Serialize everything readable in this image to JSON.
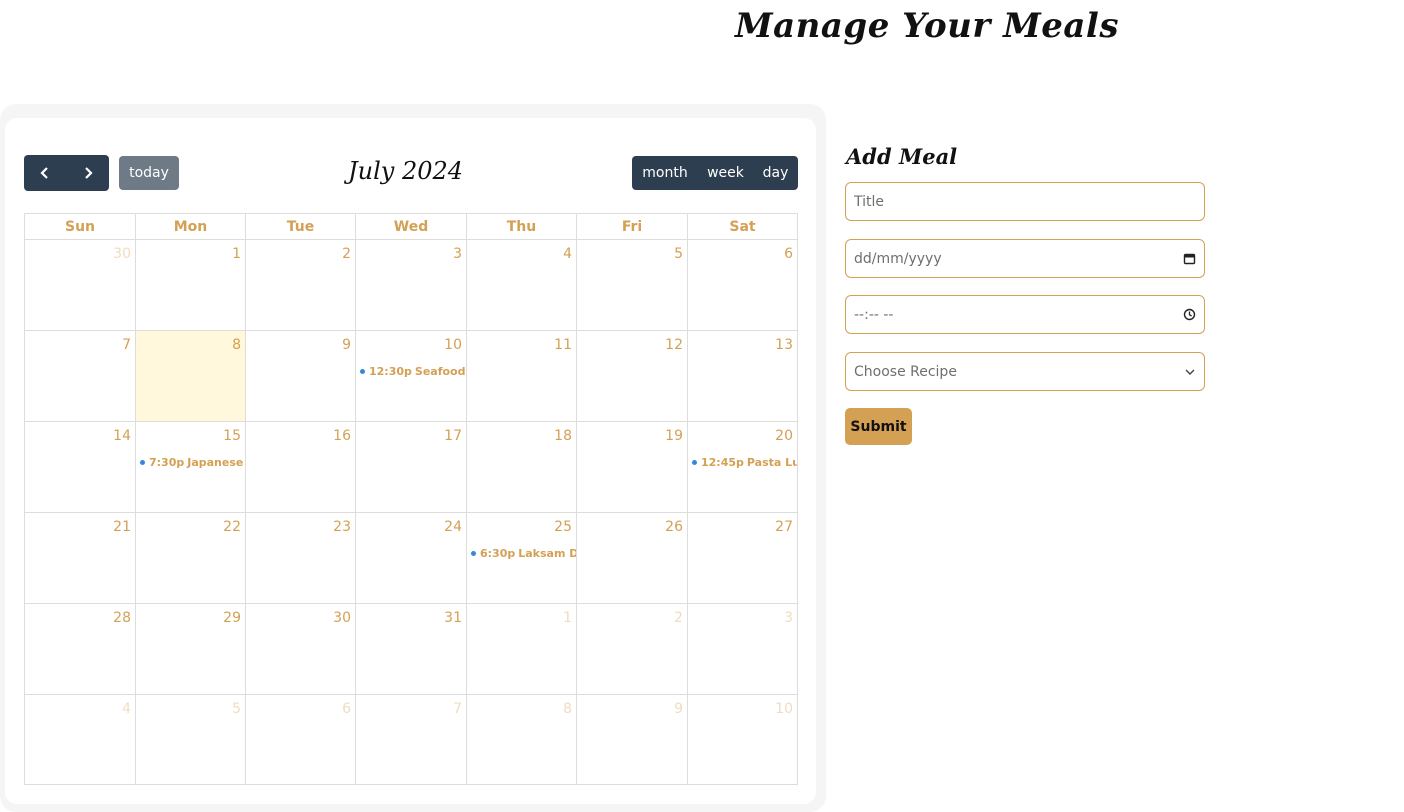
{
  "page": {
    "title": "Manage Your Meals"
  },
  "calendar": {
    "title": "July 2024",
    "today_label": "today",
    "views": [
      {
        "label": "month",
        "active": true
      },
      {
        "label": "week",
        "active": false
      },
      {
        "label": "day",
        "active": false
      }
    ],
    "weekdays": [
      "Sun",
      "Mon",
      "Tue",
      "Wed",
      "Thu",
      "Fri",
      "Sat"
    ],
    "weeks": [
      [
        {
          "day": "30",
          "other": true
        },
        {
          "day": "1"
        },
        {
          "day": "2"
        },
        {
          "day": "3"
        },
        {
          "day": "4"
        },
        {
          "day": "5"
        },
        {
          "day": "6"
        }
      ],
      [
        {
          "day": "7"
        },
        {
          "day": "8",
          "today": true
        },
        {
          "day": "9"
        },
        {
          "day": "10",
          "event": {
            "time": "12:30p",
            "title": "Seafood"
          }
        },
        {
          "day": "11"
        },
        {
          "day": "12"
        },
        {
          "day": "13"
        }
      ],
      [
        {
          "day": "14"
        },
        {
          "day": "15",
          "event": {
            "time": "7:30p",
            "title": "Japanese !"
          }
        },
        {
          "day": "16"
        },
        {
          "day": "17"
        },
        {
          "day": "18"
        },
        {
          "day": "19"
        },
        {
          "day": "20",
          "event": {
            "time": "12:45p",
            "title": "Pasta Lur"
          }
        }
      ],
      [
        {
          "day": "21"
        },
        {
          "day": "22"
        },
        {
          "day": "23"
        },
        {
          "day": "24"
        },
        {
          "day": "25",
          "event": {
            "time": "6:30p",
            "title": "Laksam D"
          }
        },
        {
          "day": "26"
        },
        {
          "day": "27"
        }
      ],
      [
        {
          "day": "28"
        },
        {
          "day": "29"
        },
        {
          "day": "30"
        },
        {
          "day": "31"
        },
        {
          "day": "1",
          "other": true
        },
        {
          "day": "2",
          "other": true
        },
        {
          "day": "3",
          "other": true
        }
      ],
      [
        {
          "day": "4",
          "other": true
        },
        {
          "day": "5",
          "other": true
        },
        {
          "day": "6",
          "other": true
        },
        {
          "day": "7",
          "other": true
        },
        {
          "day": "8",
          "other": true
        },
        {
          "day": "9",
          "other": true
        },
        {
          "day": "10",
          "other": true
        }
      ]
    ]
  },
  "form": {
    "heading": "Add Meal",
    "title_placeholder": "Title",
    "date_placeholder": "dd/mm/yyyy",
    "time_placeholder": "--:-- --",
    "recipe_placeholder": "Choose Recipe",
    "submit_label": "Submit"
  },
  "colors": {
    "accent": "#d4a054",
    "nav_dark": "#2c3e50",
    "today_bg": "#fff8dc",
    "event_dot": "#3788d8"
  }
}
